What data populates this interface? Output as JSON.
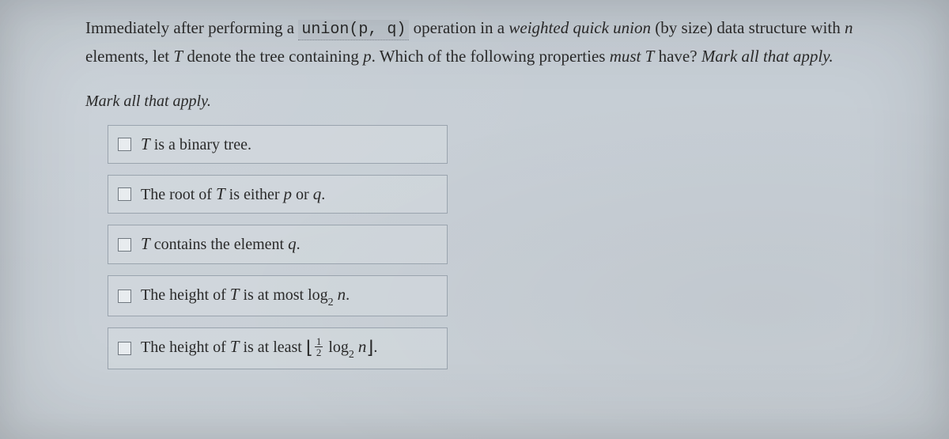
{
  "question": {
    "seg1": "Immediately after performing a ",
    "code": "union(p, q)",
    "seg2": " operation in a ",
    "emph1": "weighted quick union",
    "seg3": " (by size) data structure with ",
    "var_n": "n",
    "seg4": " elements, let ",
    "var_T": "T",
    "seg5": " denote the tree containing ",
    "var_p": "p",
    "seg6": ". Which of the following properties ",
    "emph2": "must",
    "seg7": " ",
    "var_T2": "T",
    "seg8": " have?  ",
    "emph3": "Mark all that apply."
  },
  "instruction": "Mark all that apply.",
  "options": [
    {
      "pre": "",
      "mathparts": [
        {
          "type": "var",
          "text": "T"
        },
        {
          "type": "text",
          "text": " is a binary tree."
        }
      ]
    },
    {
      "pre": "The root of ",
      "mathparts": [
        {
          "type": "var",
          "text": "T"
        },
        {
          "type": "text",
          "text": " is either "
        },
        {
          "type": "var",
          "text": "p"
        },
        {
          "type": "text",
          "text": " or "
        },
        {
          "type": "var",
          "text": "q"
        },
        {
          "type": "text",
          "text": "."
        }
      ]
    },
    {
      "pre": "",
      "mathparts": [
        {
          "type": "var",
          "text": "T"
        },
        {
          "type": "text",
          "text": " contains the element "
        },
        {
          "type": "var",
          "text": "q"
        },
        {
          "type": "text",
          "text": "."
        }
      ]
    },
    {
      "pre": "The height of ",
      "mathparts": [
        {
          "type": "var",
          "text": "T"
        },
        {
          "type": "text",
          "text": " is at most "
        },
        {
          "type": "log",
          "base": "2",
          "arg": "n"
        },
        {
          "type": "text",
          "text": "."
        }
      ]
    },
    {
      "pre": "The height of ",
      "mathparts": [
        {
          "type": "var",
          "text": "T"
        },
        {
          "type": "text",
          "text": " is at least "
        },
        {
          "type": "floor_open"
        },
        {
          "type": "frac",
          "num": "1",
          "den": "2"
        },
        {
          "type": "text",
          "text": " "
        },
        {
          "type": "log",
          "base": "2",
          "arg": "n"
        },
        {
          "type": "floor_close"
        },
        {
          "type": "text",
          "text": "."
        }
      ]
    }
  ]
}
